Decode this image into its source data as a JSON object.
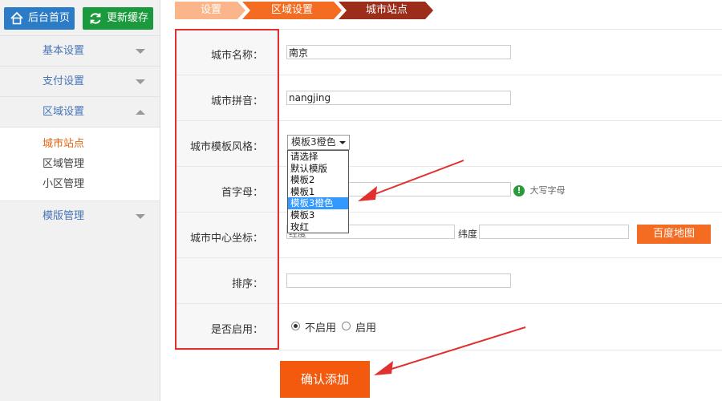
{
  "topbar": {
    "home_label": "后台首页",
    "refresh_label": "更新缓存"
  },
  "sidebar": {
    "groups": [
      {
        "label": "基本设置"
      },
      {
        "label": "支付设置"
      },
      {
        "label": "区域设置"
      },
      {
        "label": "模版管理"
      }
    ],
    "subitems": [
      "城市站点",
      "区域管理",
      "小区管理"
    ]
  },
  "breadcrumb": [
    "设置",
    "区域设置",
    "城市站点"
  ],
  "form": {
    "city_name_label": "城市名称：",
    "city_name_value": "南京",
    "pinyin_label": "城市拼音：",
    "pinyin_value": "nangjing",
    "template_label": "城市模板风格：",
    "template_selected": "模板3橙色",
    "template_options": [
      "请选择",
      "默认模版",
      "模板2",
      "模板1",
      "模板3橙色",
      "模板3",
      "玫红"
    ],
    "initial_label": "首字母：",
    "initial_hint": "大写字母",
    "coords_label": "城市中心坐标：",
    "longitude_partial": "经度",
    "latitude_label": "纬度",
    "map_button": "百度地图",
    "sort_label": "排序：",
    "enable_label": "是否启用：",
    "radio_disabled": "不启用",
    "radio_enabled": "启用",
    "submit_label": "确认添加"
  },
  "colors": {
    "accent_orange": "#f45a0e",
    "highlight_red": "#e03030",
    "link_blue": "#4774b8"
  }
}
